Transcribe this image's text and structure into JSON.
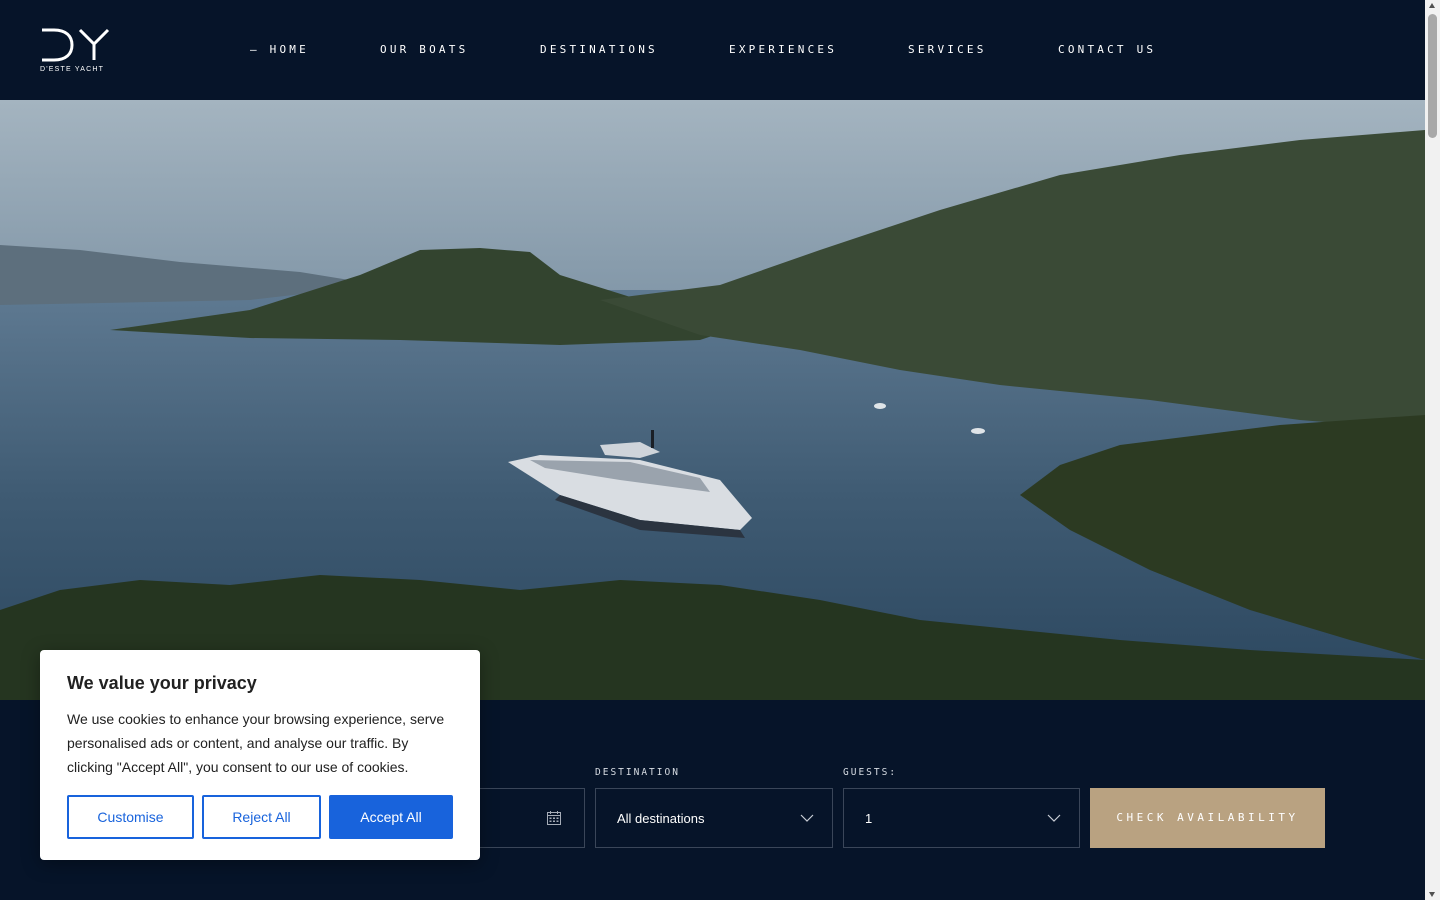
{
  "brand": {
    "logo_mark": "DY",
    "name": "D'ESTE YACHT"
  },
  "nav": {
    "items": [
      {
        "label": "— HOME",
        "active": true
      },
      {
        "label": "OUR BOATS"
      },
      {
        "label": "DESTINATIONS"
      },
      {
        "label": "EXPERIENCES"
      },
      {
        "label": "SERVICES"
      },
      {
        "label": "CONTACT US"
      }
    ]
  },
  "booking": {
    "date_icon": "calendar-icon",
    "destination": {
      "label": "DESTINATION",
      "value": "All destinations"
    },
    "guests": {
      "label": "GUESTS:",
      "value": "1"
    },
    "check_label": "CHECK AVAILABILITY"
  },
  "cookie": {
    "title": "We value your privacy",
    "body": "We use cookies to enhance your browsing experience, serve personalised ads or content, and analyse our traffic. By clicking \"Accept All\", you consent to our use of cookies.",
    "customise": "Customise",
    "reject": "Reject All",
    "accept": "Accept All"
  },
  "colors": {
    "navy": "#061429",
    "gold": "#b9a281",
    "cookie_blue": "#1863dc"
  }
}
